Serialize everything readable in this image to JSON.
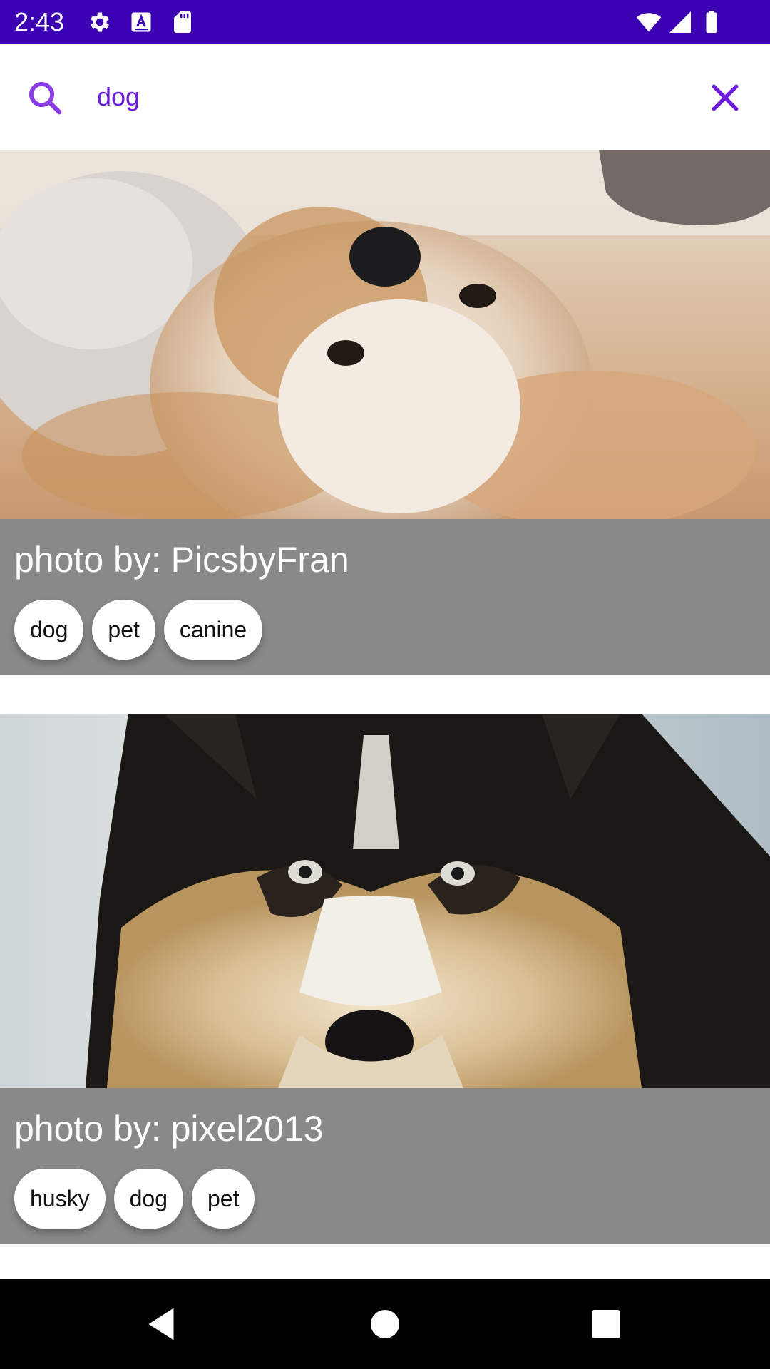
{
  "status_bar": {
    "time": "2:43",
    "icons": [
      "gear-icon",
      "text-a-icon",
      "sd-card-icon",
      "wifi-icon",
      "signal-icon",
      "battery-icon"
    ],
    "background": "#3c00b3"
  },
  "search": {
    "query": "dog",
    "accent_color": "#6a1bdb",
    "search_icon": "search-icon",
    "clear_icon": "close-icon"
  },
  "results": [
    {
      "credit": "photo by: PicsbyFran",
      "tags": [
        "dog",
        "pet",
        "canine"
      ],
      "image": "dog-lying-on-floor-photo"
    },
    {
      "credit": "photo by: pixel2013",
      "tags": [
        "husky",
        "dog",
        "pet"
      ],
      "image": "husky-face-photo"
    }
  ],
  "nav_bar": {
    "buttons": [
      "back-icon",
      "home-icon",
      "recents-icon"
    ]
  }
}
